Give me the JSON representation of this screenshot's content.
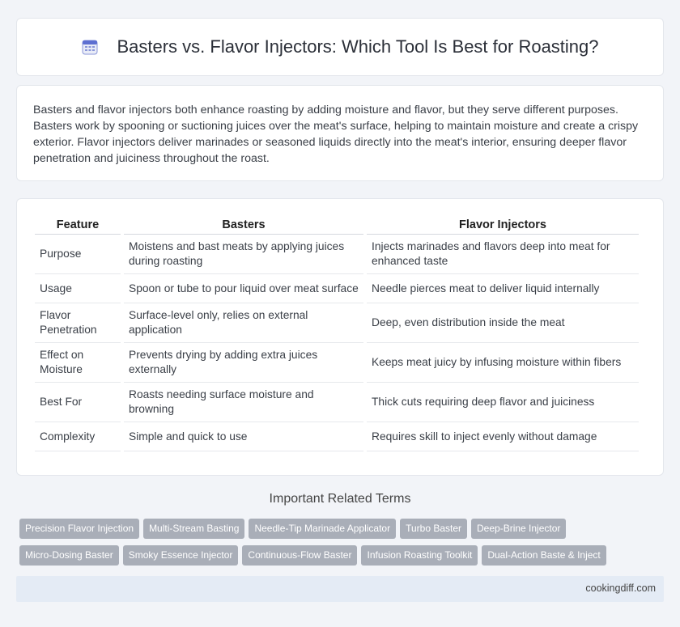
{
  "header": {
    "title": "Basters vs. Flavor Injectors: Which Tool Is Best for Roasting?",
    "icon": "calendar-icon"
  },
  "intro": "Basters and flavor injectors both enhance roasting by adding moisture and flavor, but they serve different purposes. Basters work by spooning or suctioning juices over the meat's surface, helping to maintain moisture and create a crispy exterior. Flavor injectors deliver marinades or seasoned liquids directly into the meat's interior, ensuring deeper flavor penetration and juiciness throughout the roast.",
  "table": {
    "headers": [
      "Feature",
      "Basters",
      "Flavor Injectors"
    ],
    "rows": [
      [
        "Purpose",
        "Moistens and bast meats by applying juices during roasting",
        "Injects marinades and flavors deep into meat for enhanced taste"
      ],
      [
        "Usage",
        "Spoon or tube to pour liquid over meat surface",
        "Needle pierces meat to deliver liquid internally"
      ],
      [
        "Flavor Penetration",
        "Surface-level only, relies on external application",
        "Deep, even distribution inside the meat"
      ],
      [
        "Effect on Moisture",
        "Prevents drying by adding extra juices externally",
        "Keeps meat juicy by infusing moisture within fibers"
      ],
      [
        "Best For",
        "Roasts needing surface moisture and browning",
        "Thick cuts requiring deep flavor and juiciness"
      ],
      [
        "Complexity",
        "Simple and quick to use",
        "Requires skill to inject evenly without damage"
      ]
    ]
  },
  "related": {
    "title": "Important Related Terms",
    "tags": [
      "Precision Flavor Injection",
      "Multi-Stream Basting",
      "Needle-Tip Marinade Applicator",
      "Turbo Baster",
      "Deep-Brine Injector",
      "Micro-Dosing Baster",
      "Smoky Essence Injector",
      "Continuous-Flow Baster",
      "Infusion Roasting Toolkit",
      "Dual-Action Baste & Inject"
    ]
  },
  "footer": "cookingdiff.com"
}
